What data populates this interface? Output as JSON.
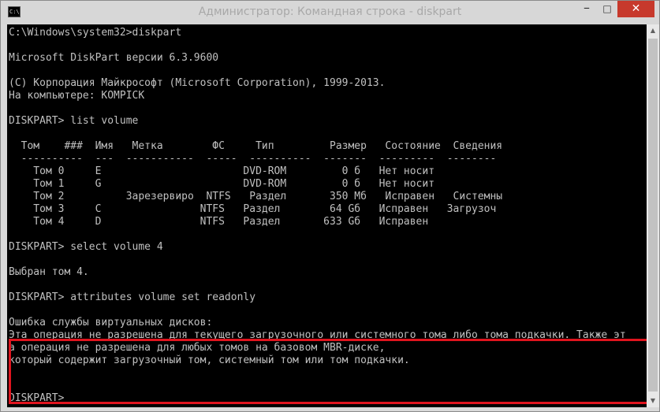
{
  "window": {
    "title": "Администратор: Командная строка - diskpart",
    "icon_label": "C:\\",
    "buttons": {
      "minimize": "–",
      "maximize": "□",
      "close": "✕"
    }
  },
  "console": {
    "lines": [
      "C:\\Windows\\system32>diskpart",
      "",
      "Microsoft DiskPart версии 6.3.9600",
      "",
      "(C) Корпорация Майкрософт (Microsoft Corporation), 1999-2013.",
      "На компьютере: KOMPICK",
      "",
      "DISKPART> list volume",
      "",
      "  Том    ###  Имя   Метка        ФС     Тип         Размер   Состояние  Сведения",
      "  ----------  ---  -----------  -----  ----------  -------  ---------  --------",
      "    Том 0     E                       DVD-ROM         0 б   Нет носит",
      "    Том 1     G                       DVD-ROM         0 б   Нет носит",
      "    Том 2          Зарезервиро  NTFS   Раздел       350 Мб   Исправен   Системны",
      "    Том 3     C                NTFS   Раздел        64 Gб   Исправен   Загрузоч",
      "    Том 4     D                NTFS   Раздел       633 Gб   Исправен",
      "",
      "DISKPART> select volume 4",
      "",
      "Выбран том 4.",
      "",
      "DISKPART> attributes volume set readonly",
      "",
      "Ошибка службы виртуальных дисков:",
      "Эта операция не разрешена для текущего загрузочного или системного тома либо тома подкачки. Также эт",
      "а операция не разрешена для любых томов на базовом MBR-диске,",
      "который содержит загрузочный том, системный том или том подкачки.",
      "",
      "",
      "DISKPART>"
    ]
  },
  "annotation": {
    "color": "#e0141e"
  },
  "colors": {
    "console_bg": "#000000",
    "console_text": "#c0c0c0",
    "close_button": "#c7392c"
  }
}
